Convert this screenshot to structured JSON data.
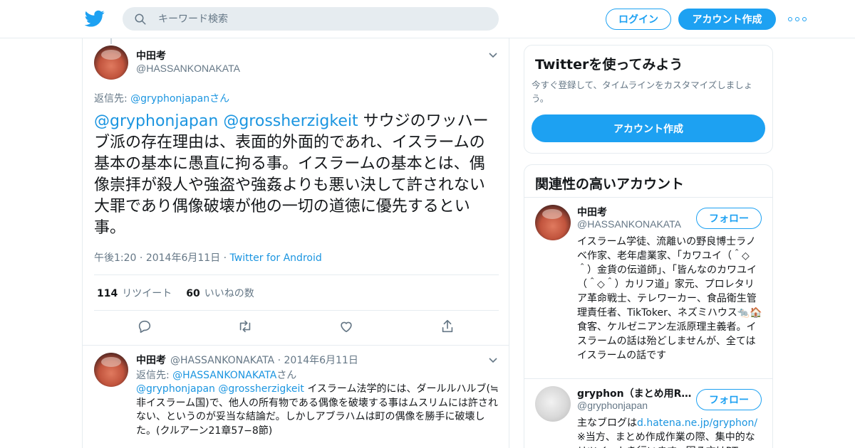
{
  "topbar": {
    "search_placeholder": "キーワード検索",
    "login_label": "ログイン",
    "signup_label": "アカウント作成"
  },
  "main_tweet": {
    "name": "中田考",
    "handle": "@HASSANKONAKATA",
    "reply_prefix": "返信先: ",
    "reply_link": "@gryphonjapan",
    "reply_suffix": "さん",
    "mention1": "@gryphonjapan",
    "mention2": "@grossherzigkeit",
    "body": "サウジのワッハーブ派の存在理由は、表面的外面的であれ、イスラームの基本の基本に愚直に拘る事。イスラームの基本とは、偶像崇拝が殺人や強盗や強姦よりも悪い決して許されない大罪であり偶像破壊が他の一切の道徳に優先するとい事。",
    "time": "午後1:20",
    "date": "2014年6月11日",
    "source": "Twitter for Android",
    "retweet_count": "114",
    "retweet_label": "リツイート",
    "like_count": "60",
    "like_label": "いいねの数"
  },
  "reply_tweet": {
    "name": "中田考",
    "handle": "@HASSANKONAKATA",
    "date": "2014年6月11日",
    "reply_prefix": "返信先: ",
    "reply_link": "@HASSANKONAKATA",
    "reply_suffix": "さん",
    "mention1": "@gryphonjapan",
    "mention2": "@grossherzigkeit",
    "body": "イスラーム法学的には、ダールルハルブ(≒非イスラーム国)で、他人の所有物である偶像を破壊する事はムスリムには許されない、というのが妥当な結論だ。しかしアブラハムは町の偶像を勝手に破壊した。(クルアーン21章57−8節)"
  },
  "sidebar": {
    "signup_card": {
      "title": "Twitterを使ってみよう",
      "description": "今すぐ登録して、タイムラインをカスタマイズしましょう。",
      "button": "アカウント作成"
    },
    "related": {
      "title": "関連性の高いアカウント",
      "accounts": [
        {
          "name": "中田考",
          "handle": "@HASSANKONAKATA",
          "follow_label": "フォロー",
          "bio": "イスラーム学徒、流離いの野良博士ラノベ作家、老年虐業家、「カワユイ（＾◇＾）金貨の伝道師」、「皆んなのカワユイ（＾◇＾）カリフ道」家元、プロレタリア革命戦士、テレワーカー、食品衛生管理責任者、TikToker、ネズミハウス🐀🏠食客、ケルゼニアン左派原理主義者。イスラームの話は殆どしませんが、全てはイスラームの話です"
        },
        {
          "name": "gryphon（まとめ用R…",
          "handle": "@gryphonjapan",
          "follow_label": "フォロー",
          "bio_prefix": "主なブログは",
          "bio_link": "d.hatena.ne.jp/gryphon/",
          "bio_rest": "※当方、まとめ作成作業の際、集中的なリツイートを行います。困る方はRT"
        }
      ]
    }
  },
  "colors": {
    "brand": "#1da1f2",
    "link": "#1b95e0",
    "muted": "#657786",
    "border": "#e6ecf0"
  },
  "icons": [
    "twitter-logo-icon",
    "search-icon",
    "more-icon",
    "chevron-down-icon",
    "reply-icon",
    "retweet-icon",
    "like-icon",
    "share-icon"
  ]
}
